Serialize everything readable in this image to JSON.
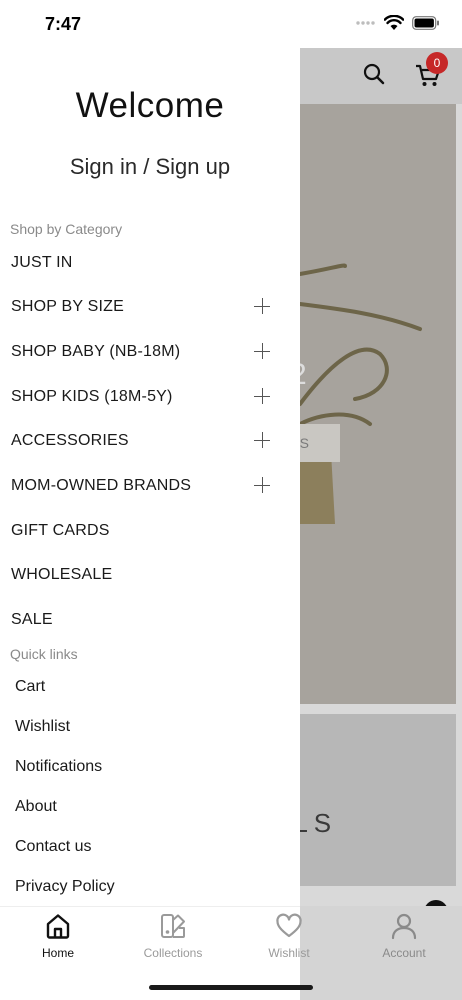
{
  "status_bar": {
    "time": "7:47"
  },
  "drawer": {
    "welcome": "Welcome",
    "sign_in": "Sign in / Sign up",
    "category_section_label": "Shop by Category",
    "categories": [
      {
        "label": "JUST IN",
        "expandable": false
      },
      {
        "label": "SHOP BY SIZE",
        "expandable": true
      },
      {
        "label": "SHOP BABY (NB-18M)",
        "expandable": true
      },
      {
        "label": "SHOP KIDS (18M-5Y)",
        "expandable": true
      },
      {
        "label": "ACCESSORIES",
        "expandable": true
      },
      {
        "label": "MOM-OWNED BRANDS",
        "expandable": true
      },
      {
        "label": "GIFT CARDS",
        "expandable": false
      },
      {
        "label": "WHOLESALE",
        "expandable": false
      },
      {
        "label": "SALE",
        "expandable": false
      }
    ],
    "quick_links_label": "Quick links",
    "quick_links": [
      "Cart",
      "Wishlist",
      "Notifications",
      "About",
      "Contact us",
      "Privacy Policy"
    ]
  },
  "background": {
    "cart_count": "0",
    "hero_button_fragment": "LS",
    "hero_number_fragment": "2",
    "banner_text_fragment": "ALS"
  },
  "tab_bar": {
    "tabs": [
      {
        "label": "Home",
        "icon": "home-icon",
        "active": true
      },
      {
        "label": "Collections",
        "icon": "collections-icon",
        "active": false
      },
      {
        "label": "Wishlist",
        "icon": "heart-icon",
        "active": false
      },
      {
        "label": "Account",
        "icon": "account-icon",
        "active": false
      }
    ]
  },
  "colors": {
    "badge": "#c62828",
    "active_tab": "#111111",
    "inactive_tab": "#9a9a9a"
  }
}
